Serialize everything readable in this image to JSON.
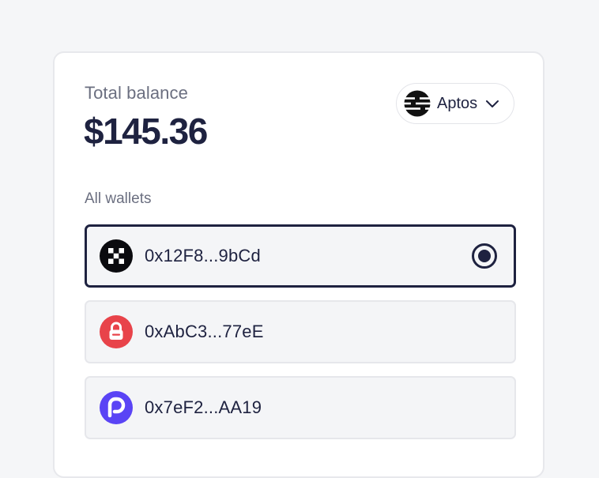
{
  "balance": {
    "label": "Total balance",
    "value": "$145.36"
  },
  "network": {
    "name": "Aptos",
    "icon": "aptos-logo-icon"
  },
  "wallets": {
    "section_label": "All wallets",
    "items": [
      {
        "address": "0x12F8...9bCd",
        "icon": "okx-wallet-icon",
        "selected": true
      },
      {
        "address": "0xAbC3...77eE",
        "icon": "red-lock-wallet-icon",
        "selected": false
      },
      {
        "address": "0x7eF2...AA19",
        "icon": "purple-r-wallet-icon",
        "selected": false
      }
    ]
  },
  "colors": {
    "text_primary": "#1e2240",
    "text_secondary": "#6b6f80",
    "wallet_red": "#e8434a",
    "wallet_purple": "#5a44f5"
  }
}
